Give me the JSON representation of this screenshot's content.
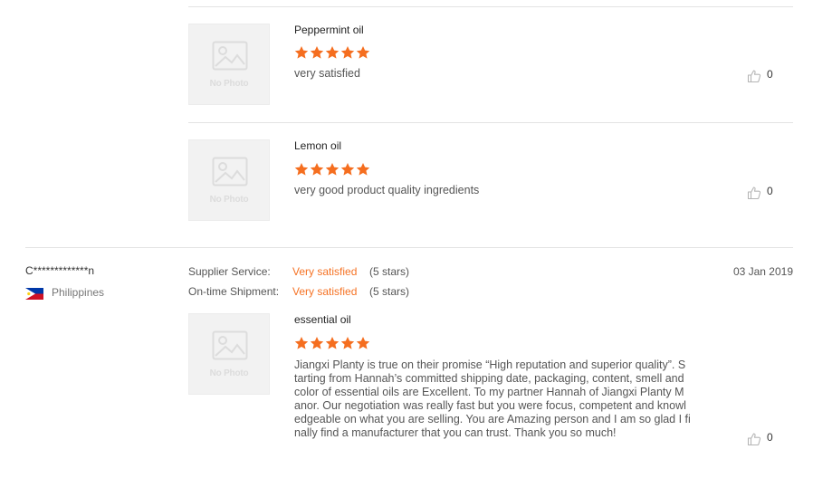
{
  "reviews": [
    {
      "product": "Peppermint oil",
      "rating": 5,
      "text": "very satisfied",
      "likes": "0",
      "photo_label": "No Photo"
    },
    {
      "product": "Lemon oil",
      "rating": 5,
      "text": "very good product quality ingredients",
      "likes": "0",
      "photo_label": "No Photo"
    }
  ],
  "reviewer": {
    "name": "C*************n",
    "country": "Philippines",
    "date": "03 Jan 2019",
    "supplier_service_label": "Supplier Service:",
    "supplier_service_value": "Very satisfied",
    "supplier_service_stars": "(5 stars)",
    "shipment_label": "On-time Shipment:",
    "shipment_value": "Very satisfied",
    "shipment_stars": "(5 stars)",
    "item": {
      "product": "essential oil",
      "rating": 5,
      "photo_label": "No Photo",
      "text_lines": [
        "Jiangxi Planty is true on their promise “High reputation and superior quality”. S",
        "tarting from Hannah’s committed shipping date, packaging, content, smell and",
        "color of essential oils are Excellent. To my partner Hannah of Jiangxi Planty M",
        "anor. Our negotiation was really fast but you were focus, competent and knowl",
        "edgeable on what you are selling. You are Amazing person and I am so glad I fi",
        "nally find a manufacturer that you can trust. Thank you so much!"
      ],
      "likes": "0"
    }
  },
  "colors": {
    "star": "#f56e1f",
    "accent": "#f57224",
    "divider": "#e3e3e3"
  },
  "icons": [
    "no-photo-icon",
    "star-icon",
    "thumbs-up-icon",
    "philippines-flag-icon"
  ]
}
